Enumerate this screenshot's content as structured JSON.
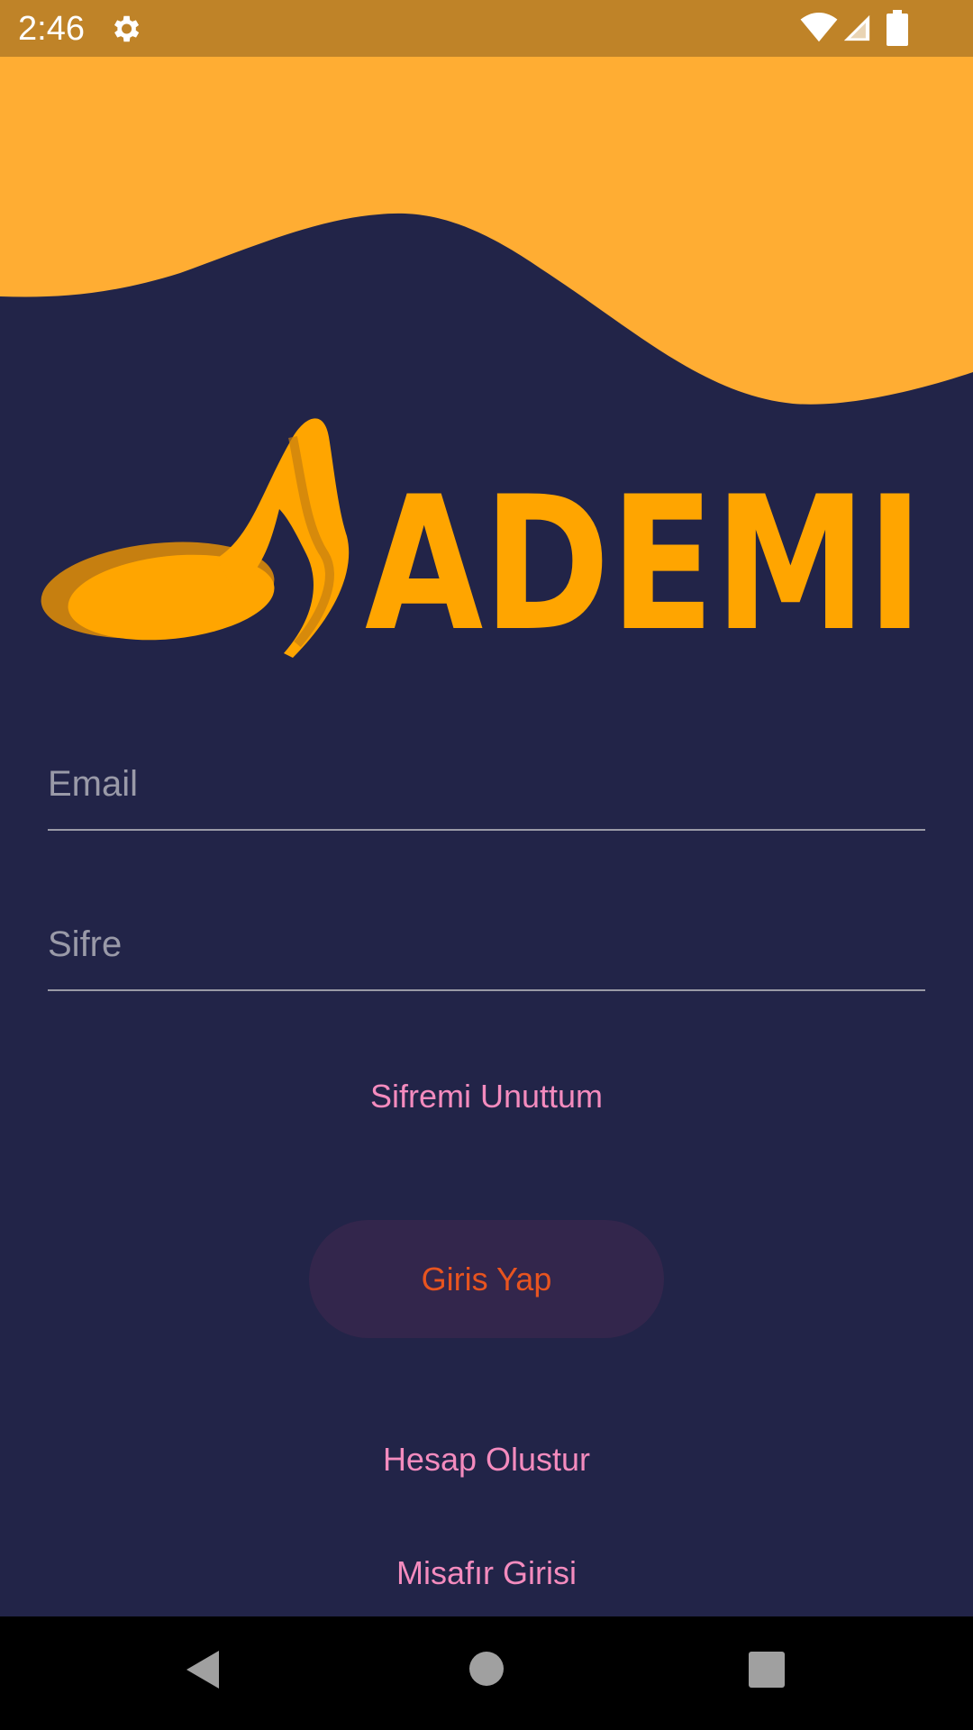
{
  "status_bar": {
    "time": "2:46",
    "icons": [
      "settings-gear-icon",
      "wifi-icon",
      "cell-signal-icon",
      "battery-icon"
    ]
  },
  "logo": {
    "text": "ADEMI",
    "icon": "music-note-icon",
    "color": "#FFA500"
  },
  "form": {
    "email_placeholder": "Email",
    "email_value": "",
    "password_placeholder": "Sifre",
    "password_value": ""
  },
  "links": {
    "forgot_password": "Sifremi Unuttum",
    "create_account": "Hesap Olustur",
    "guest_login": "Misafır Girisi"
  },
  "login_button": {
    "label": "Giris Yap"
  },
  "navigation_bar": {
    "icons": [
      "back-icon",
      "home-icon",
      "recents-icon"
    ]
  },
  "colors": {
    "background": "#222448",
    "wave_accent": "#FFAD33",
    "status_bar": "#BF8328",
    "link_pink": "#F48BBE",
    "button_text": "#E8541F",
    "button_background": "#33264C"
  }
}
